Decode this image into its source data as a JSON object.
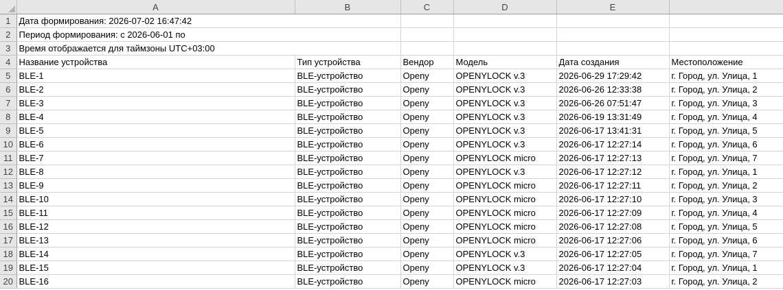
{
  "columns": [
    "A",
    "B",
    "C",
    "D",
    "E"
  ],
  "info_rows": [
    {
      "row": "1",
      "text": "Дата формирования: 2026-07-02 16:47:42"
    },
    {
      "row": "2",
      "text": "Период формирования: с 2026-06-01 по"
    },
    {
      "row": "3",
      "text": "Время отображается для таймзоны UTC+03:00"
    }
  ],
  "header_row": {
    "row": "4",
    "cells": [
      "Название устройства",
      "Тип устройства",
      "Вендор",
      "Модель",
      "Дата создания",
      "Местоположение"
    ]
  },
  "data_rows": [
    {
      "row": "5",
      "cells": [
        "BLE-1",
        "BLE-устройство",
        "Openy",
        "OPENYLOCK v.3",
        "2026-06-29 17:29:42",
        "г. Город, ул. Улица, 1"
      ]
    },
    {
      "row": "6",
      "cells": [
        "BLE-2",
        "BLE-устройство",
        "Openy",
        "OPENYLOCK v.3",
        "2026-06-26 12:33:38",
        "г. Город, ул. Улица, 2"
      ]
    },
    {
      "row": "7",
      "cells": [
        "BLE-3",
        "BLE-устройство",
        "Openy",
        "OPENYLOCK v.3",
        "2026-06-26 07:51:47",
        "г. Город, ул. Улица, 3"
      ]
    },
    {
      "row": "8",
      "cells": [
        "BLE-4",
        "BLE-устройство",
        "Openy",
        "OPENYLOCK v.3",
        "2026-06-19 13:31:49",
        "г. Город, ул. Улица, 4"
      ]
    },
    {
      "row": "9",
      "cells": [
        "BLE-5",
        "BLE-устройство",
        "Openy",
        "OPENYLOCK v.3",
        "2026-06-17 13:41:31",
        "г. Город, ул. Улица, 5"
      ]
    },
    {
      "row": "10",
      "cells": [
        "BLE-6",
        "BLE-устройство",
        "Openy",
        "OPENYLOCK v.3",
        "2026-06-17 12:27:14",
        "г. Город, ул. Улица, 6"
      ]
    },
    {
      "row": "11",
      "cells": [
        "BLE-7",
        "BLE-устройство",
        "Openy",
        "OPENYLOCK micro",
        "2026-06-17 12:27:13",
        "г. Город, ул. Улица, 7"
      ]
    },
    {
      "row": "12",
      "cells": [
        "BLE-8",
        "BLE-устройство",
        "Openy",
        "OPENYLOCK v.3",
        "2026-06-17 12:27:12",
        "г. Город, ул. Улица, 1"
      ]
    },
    {
      "row": "13",
      "cells": [
        "BLE-9",
        "BLE-устройство",
        "Openy",
        "OPENYLOCK micro",
        "2026-06-17 12:27:11",
        "г. Город, ул. Улица, 2"
      ]
    },
    {
      "row": "14",
      "cells": [
        "BLE-10",
        "BLE-устройство",
        "Openy",
        "OPENYLOCK micro",
        "2026-06-17 12:27:10",
        "г. Город, ул. Улица, 3"
      ]
    },
    {
      "row": "15",
      "cells": [
        "BLE-11",
        "BLE-устройство",
        "Openy",
        "OPENYLOCK micro",
        "2026-06-17 12:27:09",
        "г. Город, ул. Улица, 4"
      ]
    },
    {
      "row": "16",
      "cells": [
        "BLE-12",
        "BLE-устройство",
        "Openy",
        "OPENYLOCK micro",
        "2026-06-17 12:27:08",
        "г. Город, ул. Улица, 5"
      ]
    },
    {
      "row": "17",
      "cells": [
        "BLE-13",
        "BLE-устройство",
        "Openy",
        "OPENYLOCK micro",
        "2026-06-17 12:27:06",
        "г. Город, ул. Улица, 6"
      ]
    },
    {
      "row": "18",
      "cells": [
        "BLE-14",
        "BLE-устройство",
        "Openy",
        "OPENYLOCK v.3",
        "2026-06-17 12:27:05",
        "г. Город, ул. Улица, 7"
      ]
    },
    {
      "row": "19",
      "cells": [
        "BLE-15",
        "BLE-устройство",
        "Openy",
        "OPENYLOCK v.3",
        "2026-06-17 12:27:04",
        "г. Город, ул. Улица, 1"
      ]
    },
    {
      "row": "20",
      "cells": [
        "BLE-16",
        "BLE-устройство",
        "Openy",
        "OPENYLOCK micro",
        "2026-06-17 12:27:03",
        "г. Город, ул. Улица, 2"
      ]
    }
  ],
  "colors": {
    "header_bg": "#e6e6e6",
    "gridline": "#d4d4d4",
    "header_text": "#444444"
  }
}
